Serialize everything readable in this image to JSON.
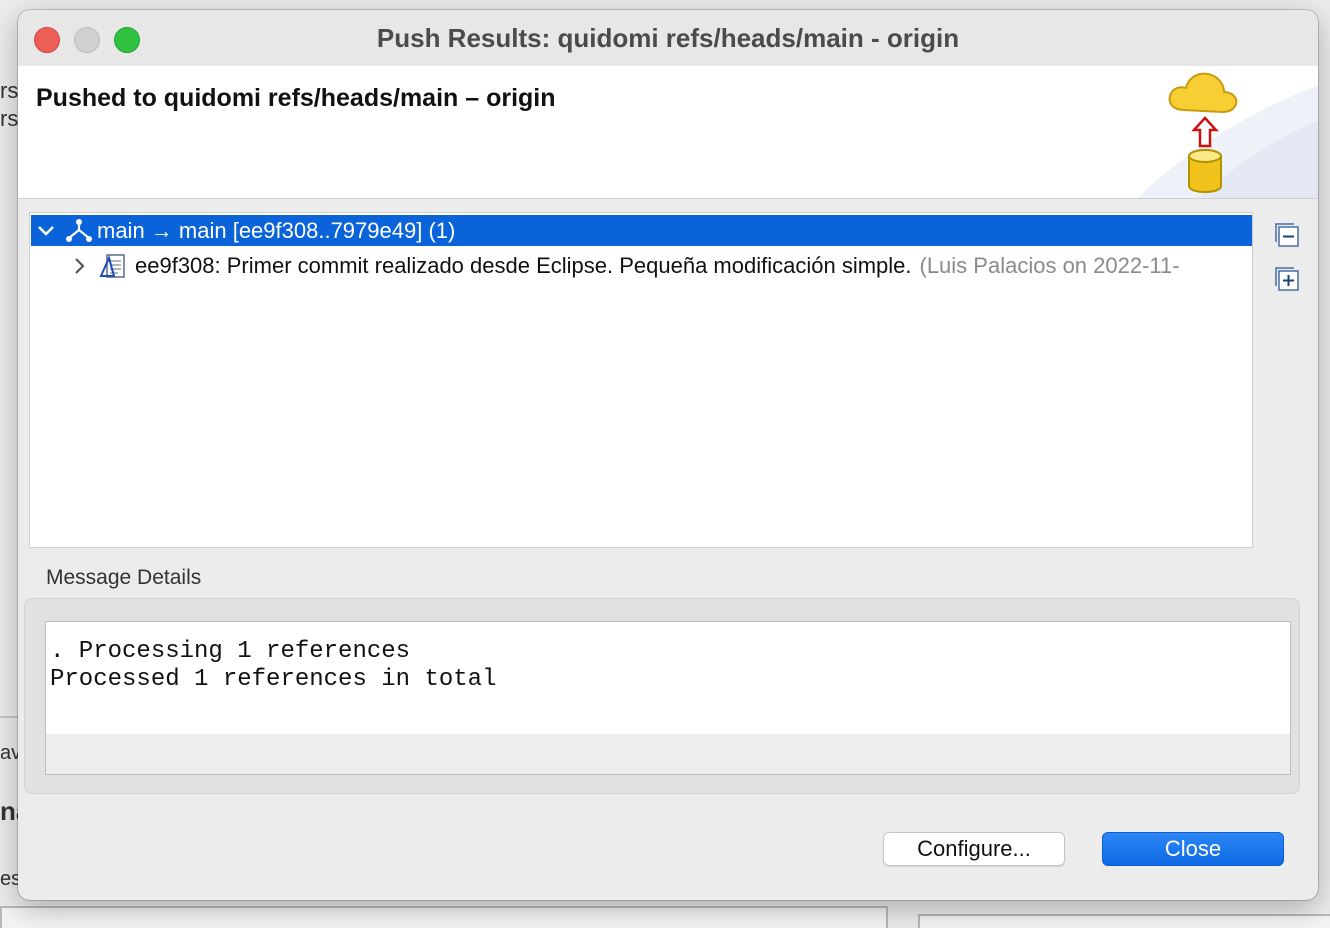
{
  "window": {
    "title": "Push Results: quidomi refs/heads/main - origin"
  },
  "banner": {
    "title": "Pushed to quidomi refs/heads/main – origin"
  },
  "tree": {
    "ref_update": "main → main [ee9f308..7979e49] (1)",
    "commit": {
      "text": "ee9f308: Primer commit realizado desde Eclipse. Pequeña modificación simple.",
      "author": "(Luis Palacios on 2022-11-"
    }
  },
  "message_details": {
    "label": "Message Details",
    "lines": [
      ". Processing 1 references",
      "Processed 1 references in total"
    ]
  },
  "buttons": {
    "configure": "Configure...",
    "close": "Close"
  },
  "background": {
    "frag1": "rs",
    "frag2": "rs",
    "frag3": "av",
    "frag4": "na",
    "frag5": "es"
  },
  "colors": {
    "selection": "#0a63d9",
    "primary_button": "#1c74ee"
  }
}
